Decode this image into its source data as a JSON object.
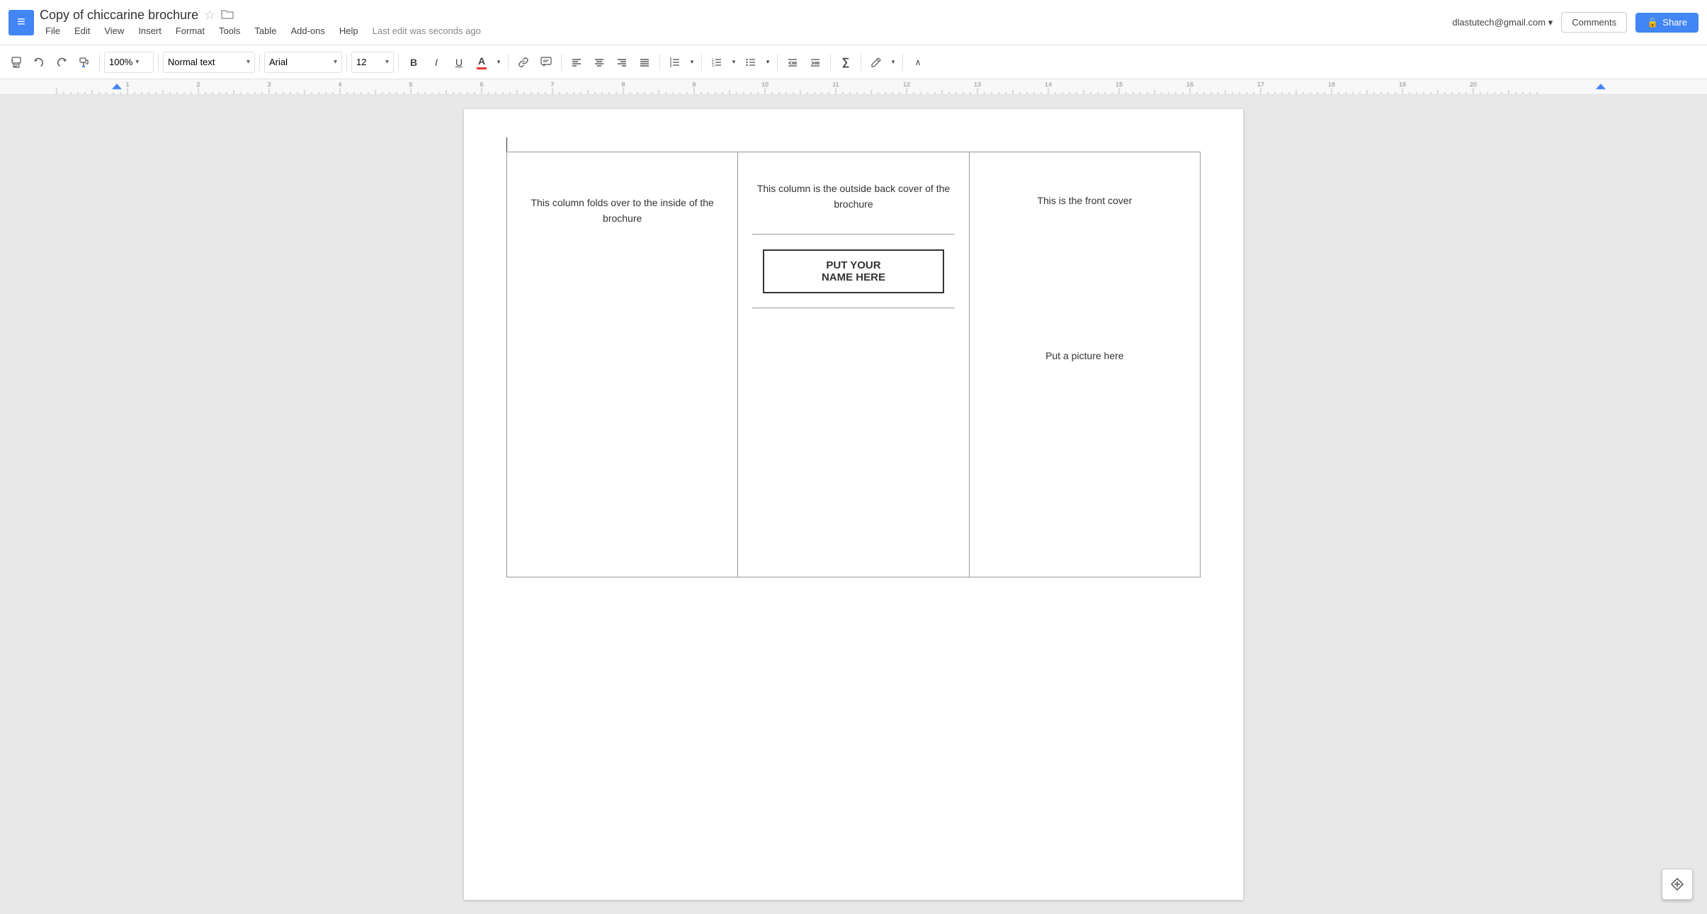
{
  "app": {
    "icon_symbol": "≡",
    "title": "Copy of chiccarine brochure",
    "star_symbol": "☆",
    "folder_symbol": "▪"
  },
  "menu": {
    "items": [
      "File",
      "Edit",
      "View",
      "Insert",
      "Format",
      "Tools",
      "Table",
      "Add-ons",
      "Help"
    ]
  },
  "status": {
    "last_edit": "Last edit was seconds ago"
  },
  "top_right": {
    "email": "dlastutech@gmail.com",
    "email_arrow": "▾",
    "comments_label": "Comments",
    "share_label": "Share",
    "lock_symbol": "🔒"
  },
  "toolbar": {
    "print_symbol": "🖨",
    "undo_symbol": "↩",
    "redo_symbol": "↪",
    "format_paint_symbol": "🖌",
    "zoom_value": "100%",
    "zoom_arrow": "▾",
    "style_value": "Normal text",
    "style_arrow": "▾",
    "font_value": "Arial",
    "font_arrow": "▾",
    "size_value": "12",
    "size_arrow": "▾",
    "bold_symbol": "B",
    "italic_symbol": "I",
    "underline_symbol": "U",
    "text_color_symbol": "A",
    "link_symbol": "🔗",
    "comment_symbol": "💬",
    "align_left": "≡",
    "align_center": "≡",
    "align_right": "≡",
    "align_justify": "≡",
    "line_spacing": "↕",
    "numbered_list": "≔",
    "bullet_list": "☰",
    "indent_decrease": "⇤",
    "indent_increase": "⇥",
    "formula": "∑",
    "drawing_pencil": "✏",
    "collapse_arrow": "∧"
  },
  "document": {
    "cursor_visible": true,
    "columns": [
      {
        "id": "col1",
        "text": "This column folds over to the inside of the brochure"
      },
      {
        "id": "col2",
        "top_text": "This column is the outside back cover of the brochure",
        "name_box_line1": "PUT YOUR",
        "name_box_line2": "NAME HERE"
      },
      {
        "id": "col3",
        "top_text": "This is the front cover",
        "picture_text": "Put a picture here"
      }
    ]
  }
}
